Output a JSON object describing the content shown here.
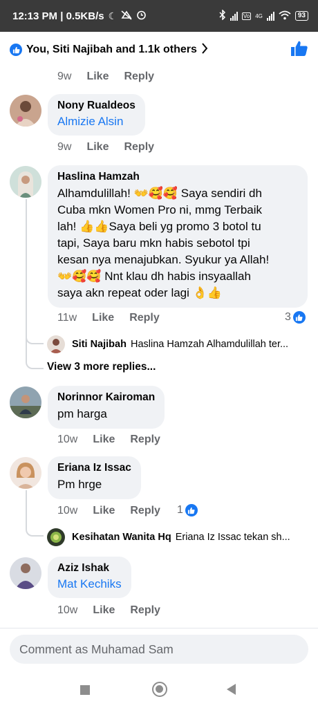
{
  "status_bar": {
    "time_speed": "12:13 PM | 0.5KB/s",
    "network": "4G",
    "battery": "93"
  },
  "reactions": {
    "summary": "You, Siti Najibah and 1.1k others",
    "color": "#1877f2"
  },
  "first_actions": {
    "time": "9w",
    "like": "Like",
    "reply": "Reply"
  },
  "comments": [
    {
      "name": "Nony Rualdeos",
      "mention": "Almizie Alsin",
      "time": "9w",
      "like": "Like",
      "reply": "Reply"
    },
    {
      "name": "Haslina Hamzah",
      "lines": [
        "Alhamdulillah! 👐🥰🥰 Saya sendiri dh",
        "Cuba mkn Women Pro ni, mmg Terbaik",
        "lah! 👍👍Saya beli yg promo 3 botol tu",
        "tapi, Saya baru mkn habis sebotol tpi",
        "kesan nya menajubkan. Syukur ya Allah!",
        "👐🥰🥰 Nnt klau dh habis insyaallah",
        "saya akn repeat oder lagi 👌👍"
      ],
      "time": "11w",
      "like": "Like",
      "reply": "Reply",
      "reaction_count": "3",
      "reply_preview": {
        "name": "Siti Najibah",
        "snippet": "Haslina Hamzah  Alhamdulillah ter..."
      },
      "more_replies": "View 3 more replies..."
    },
    {
      "name": "Norinnor Kairoman",
      "text": "pm harga",
      "time": "10w",
      "like": "Like",
      "reply": "Reply"
    },
    {
      "name": "Eriana Iz Issac",
      "text": "Pm hrge",
      "time": "10w",
      "like": "Like",
      "reply": "Reply",
      "reaction_count": "1",
      "reply_preview": {
        "name": "Kesihatan Wanita Hq",
        "snippet": "Eriana Iz Issac  tekan sh..."
      }
    },
    {
      "name": "Aziz Ishak",
      "mention": "Mat Kechiks",
      "time": "10w",
      "like": "Like",
      "reply": "Reply"
    }
  ],
  "composer": {
    "placeholder": "Comment as Muhamad Sam"
  },
  "icons": {
    "moon": "moon-icon",
    "bluetooth": "bluetooth-icon",
    "wifi": "wifi-icon",
    "like_badge": "like-badge-icon",
    "chevron": "chevron-right-icon"
  }
}
